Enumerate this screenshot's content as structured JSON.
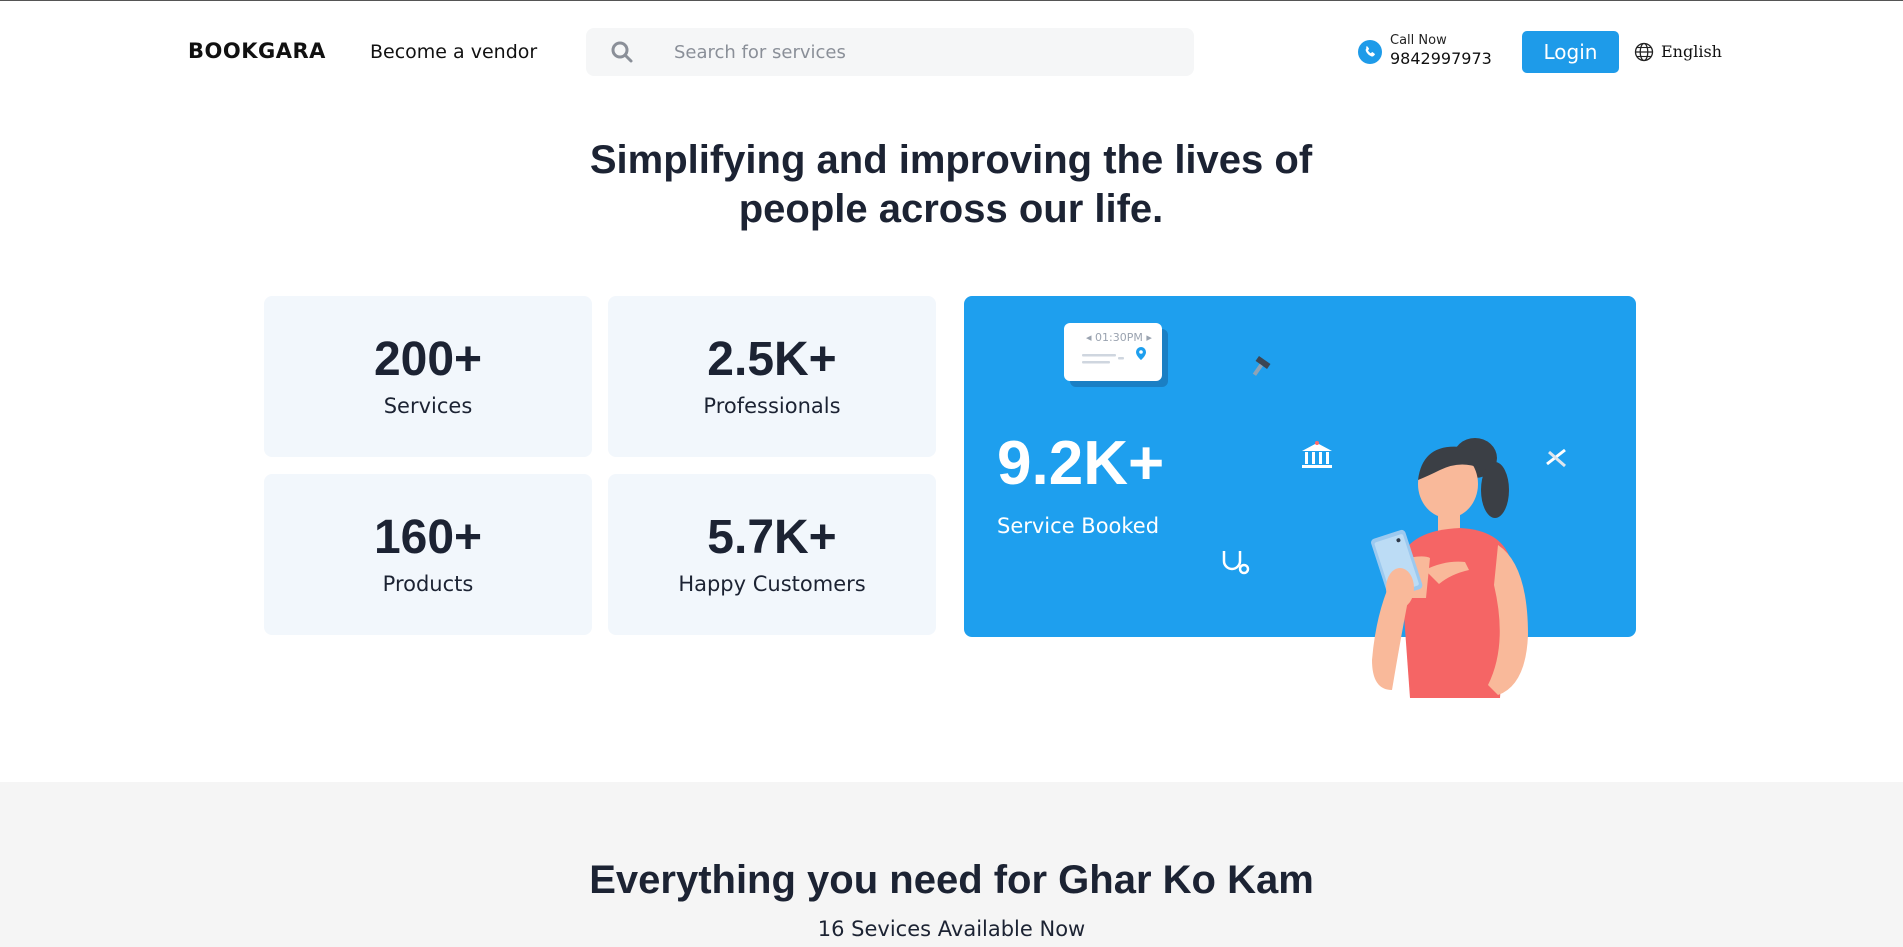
{
  "header": {
    "logo": "BOOKGARA",
    "vendor_link": "Become a vendor",
    "search_placeholder": "Search for services",
    "call_label": "Call Now",
    "call_number": "9842997973",
    "login_label": "Login",
    "language": "English"
  },
  "hero": {
    "title_line1": "Simplifying and improving the lives of",
    "title_line2": "people across our life."
  },
  "stats": [
    {
      "value": "200+",
      "label": "Services"
    },
    {
      "value": "2.5K+",
      "label": "Professionals"
    },
    {
      "value": "160+",
      "label": "Products"
    },
    {
      "value": "5.7K+",
      "label": "Happy Customers"
    }
  ],
  "promo": {
    "value": "9.2K+",
    "label": "Service Booked",
    "time_chip": "01:30PM"
  },
  "services_section": {
    "title_prefix": "Everything you need for ",
    "title_bold": "Ghar Ko Kam",
    "subtitle": "16 Sevices Available Now"
  },
  "colors": {
    "accent": "#1e9fee",
    "card_bg": "#f2f7fc",
    "text": "#1c2333"
  }
}
